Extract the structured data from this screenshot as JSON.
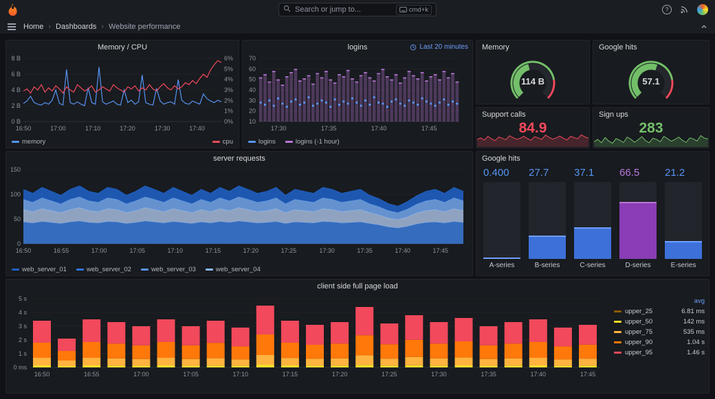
{
  "nav": {
    "search_placeholder": "Search or jump to...",
    "shortcut": "cmd+k",
    "help_glyph": "?",
    "separator": "›",
    "breadcrumb": [
      "Home",
      "Dashboards",
      "Website performance"
    ]
  },
  "panels": {
    "memcpu": {
      "title": "Memory / CPU",
      "legend": [
        {
          "label": "memory",
          "color": "#5794f2"
        },
        {
          "label": "cpu",
          "color": "#f2495c"
        }
      ],
      "chart_data": {
        "type": "line",
        "x_ticks": [
          {
            "label": "16:50",
            "f": 0
          },
          {
            "label": "17:00",
            "f": 0.175
          },
          {
            "label": "17:10",
            "f": 0.351
          },
          {
            "label": "17:20",
            "f": 0.526
          },
          {
            "label": "17:30",
            "f": 0.702
          },
          {
            "label": "17:40",
            "f": 0.877
          }
        ],
        "y_left": {
          "max": 8,
          "ticks": [
            {
              "label": "0 B",
              "v": 0
            },
            {
              "label": "2 B",
              "v": 2
            },
            {
              "label": "4 B",
              "v": 4
            },
            {
              "label": "6 B",
              "v": 6
            },
            {
              "label": "8 B",
              "v": 8
            }
          ]
        },
        "y_right": {
          "max": 6,
          "ticks": [
            {
              "label": "0%",
              "v": 0
            },
            {
              "label": "1%",
              "v": 1
            },
            {
              "label": "2%",
              "v": 2
            },
            {
              "label": "3%",
              "v": 3
            },
            {
              "label": "4%",
              "v": 4
            },
            {
              "label": "5%",
              "v": 5
            },
            {
              "label": "6%",
              "v": 6
            }
          ]
        },
        "series": [
          {
            "name": "memory",
            "axis": "left",
            "color": "#5794f2",
            "values": [
              2.3,
              2.6,
              3.2,
              2.4,
              2.2,
              2.1,
              2.4,
              2.2,
              2.7,
              4.0,
              2.3,
              2.1,
              6.6,
              2.4,
              2.2,
              2.5,
              2.2,
              2.0,
              4.3,
              2.4,
              2.2,
              6.9,
              2.5,
              2.2,
              2.4,
              2.6,
              2.2,
              2.1,
              4.0,
              2.4,
              2.7,
              2.2,
              2.5,
              5.9,
              2.4,
              2.2,
              2.1,
              4.2,
              2.6,
              2.2,
              2.4,
              2.5,
              2.2,
              5.3,
              2.7,
              2.3,
              2.2,
              2.6,
              2.4,
              2.2,
              3.5,
              2.9,
              2.6,
              2.4,
              2.7,
              2.5
            ]
          },
          {
            "name": "cpu",
            "axis": "right",
            "color": "#f2495c",
            "values": [
              2.9,
              3.1,
              2.7,
              3.3,
              3.0,
              3.5,
              2.8,
              3.2,
              2.9,
              3.4,
              3.1,
              2.7,
              3.3,
              3.0,
              2.8,
              3.5,
              3.2,
              2.9,
              3.1,
              3.4,
              2.8,
              3.0,
              3.3,
              3.1,
              2.9,
              3.5,
              3.2,
              3.0,
              2.8,
              3.3,
              3.1,
              3.4,
              2.9,
              3.2,
              3.0,
              3.5,
              3.1,
              2.9,
              3.3,
              3.6,
              3.2,
              3.0,
              3.4,
              3.1,
              3.3,
              3.7,
              3.5,
              3.9,
              3.6,
              4.1,
              4.5,
              4.2,
              4.9,
              5.4,
              5.8,
              5.6
            ]
          }
        ]
      }
    },
    "logins": {
      "title": "logins",
      "badge": "Last 20 minutes",
      "legend": [
        {
          "label": "logins",
          "color": "#5794f2"
        },
        {
          "label": "logins (-1 hour)",
          "color": "#b877d9"
        }
      ],
      "chart_data": {
        "type": "bar+scatter",
        "x_ticks": [
          {
            "label": "17:30",
            "f": 0.1
          },
          {
            "label": "17:35",
            "f": 0.35
          },
          {
            "label": "17:40",
            "f": 0.6
          },
          {
            "label": "17:45",
            "f": 0.85
          }
        ],
        "y": {
          "min": 10,
          "max": 70,
          "ticks": [
            {
              "label": "10",
              "v": 10
            },
            {
              "label": "20",
              "v": 20
            },
            {
              "label": "30",
              "v": 30
            },
            {
              "label": "40",
              "v": 40
            },
            {
              "label": "50",
              "v": 50
            },
            {
              "label": "60",
              "v": 60
            },
            {
              "label": "70",
              "v": 70
            }
          ]
        },
        "bar_color": "#b877d9",
        "point_color": "#5794f2",
        "bars": [
          52,
          55,
          48,
          58,
          50,
          45,
          53,
          57,
          60,
          49,
          51,
          54,
          46,
          56,
          52,
          58,
          50,
          47,
          55,
          53,
          59,
          51,
          48,
          54,
          57,
          52,
          49,
          56,
          60,
          53,
          50,
          55,
          47,
          52,
          58,
          54,
          51,
          57,
          49,
          53,
          55,
          50,
          58,
          52,
          56,
          48
        ],
        "points": [
          28,
          26,
          30,
          25,
          32,
          27,
          24,
          29,
          31,
          26,
          28,
          33,
          25,
          27,
          30,
          28,
          24,
          31,
          26,
          29,
          27,
          32,
          28,
          25,
          30,
          26,
          33,
          28,
          27,
          24,
          29,
          31,
          27,
          25,
          30,
          28,
          26,
          32,
          29,
          27,
          25,
          28,
          31,
          26,
          29,
          27
        ]
      }
    },
    "memory_gauge": {
      "title": "Memory",
      "value": "114 B",
      "percent": 0.45,
      "color": "#73bf69",
      "threshold_color": "#f2495c"
    },
    "google_gauge": {
      "title": "Google hits",
      "value": "57.1",
      "percent": 0.57,
      "color": "#73bf69",
      "threshold_color": "#f2495c"
    },
    "support": {
      "title": "Support calls",
      "value": "84.9",
      "color": "#f2495c",
      "spark_min": 60,
      "spark_max": 100,
      "spark": [
        80,
        85,
        78,
        90,
        82,
        76,
        88,
        84,
        79,
        92,
        86,
        80,
        84,
        90,
        83,
        77,
        89,
        85,
        80,
        94,
        87,
        81,
        85,
        91,
        84,
        78,
        90,
        86,
        82,
        95,
        88,
        84
      ]
    },
    "signups": {
      "title": "Sign ups",
      "value": "283",
      "color": "#73bf69",
      "spark_min": 240,
      "spark_max": 320,
      "spark": [
        265,
        280,
        258,
        292,
        270,
        255,
        285,
        275,
        260,
        295,
        282,
        262,
        278,
        298,
        272,
        258,
        288,
        280,
        265,
        300,
        285,
        268,
        280,
        295,
        275,
        260,
        290,
        283,
        270,
        305,
        288,
        283
      ]
    },
    "server": {
      "title": "server requests",
      "legend": [
        {
          "label": "web_server_01",
          "color": "#1f60c4"
        },
        {
          "label": "web_server_02",
          "color": "#3274d9"
        },
        {
          "label": "web_server_03",
          "color": "#5794f2"
        },
        {
          "label": "web_server_04",
          "color": "#8ab8ff"
        }
      ],
      "chart_data": {
        "type": "stacked-area",
        "x_ticks": [
          {
            "label": "16:50",
            "f": 0
          },
          {
            "label": "16:55",
            "f": 0.086
          },
          {
            "label": "17:00",
            "f": 0.172
          },
          {
            "label": "17:05",
            "f": 0.259
          },
          {
            "label": "17:10",
            "f": 0.345
          },
          {
            "label": "17:15",
            "f": 0.431
          },
          {
            "label": "17:20",
            "f": 0.517
          },
          {
            "label": "17:25",
            "f": 0.603
          },
          {
            "label": "17:30",
            "f": 0.69
          },
          {
            "label": "17:35",
            "f": 0.776
          },
          {
            "label": "17:40",
            "f": 0.862
          },
          {
            "label": "17:45",
            "f": 0.948
          }
        ],
        "y": {
          "max": 150,
          "ticks": [
            {
              "label": "0",
              "v": 0
            },
            {
              "label": "50",
              "v": 50
            },
            {
              "label": "100",
              "v": 100
            },
            {
              "label": "150",
              "v": 150
            }
          ]
        },
        "series": [
          {
            "name": "web_server_01",
            "color": "#1f60c4",
            "fill": "#3a77d4",
            "values": [
              44,
              42,
              45,
              43,
              41,
              44,
              46,
              43,
              42,
              45,
              44,
              41,
              43,
              46,
              44,
              42,
              45,
              43,
              41,
              44,
              42,
              45,
              43,
              46,
              44,
              42,
              43,
              45,
              41,
              44,
              43,
              42,
              45,
              44,
              42,
              43,
              44,
              41,
              38,
              34,
              32,
              35,
              40,
              43,
              44,
              42,
              45,
              43
            ]
          },
          {
            "name": "web_server_02",
            "color": "#3274d9",
            "fill": "#9fb6d8",
            "values": [
              25,
              23,
              26,
              24,
              22,
              25,
              27,
              24,
              23,
              26,
              25,
              22,
              24,
              27,
              25,
              23,
              26,
              24,
              22,
              25,
              23,
              26,
              24,
              27,
              25,
              23,
              24,
              26,
              22,
              25,
              24,
              23,
              26,
              25,
              23,
              24,
              25,
              22,
              20,
              18,
              17,
              19,
              22,
              24,
              25,
              23,
              26,
              24
            ]
          },
          {
            "name": "web_server_03",
            "color": "#5794f2",
            "fill": "#6fa3e8",
            "values": [
              21,
              19,
              22,
              20,
              18,
              21,
              22,
              20,
              19,
              22,
              21,
              18,
              20,
              22,
              21,
              19,
              22,
              20,
              18,
              21,
              19,
              22,
              20,
              22,
              21,
              19,
              20,
              22,
              18,
              21,
              20,
              19,
              22,
              21,
              19,
              20,
              21,
              18,
              17,
              15,
              14,
              16,
              18,
              20,
              21,
              19,
              22,
              20
            ]
          },
          {
            "name": "web_server_04",
            "color": "#8ab8ff",
            "fill": "#1f60c4",
            "values": [
              20,
              18,
              21,
              19,
              17,
              20,
              22,
              19,
              18,
              21,
              20,
              17,
              19,
              22,
              20,
              18,
              21,
              19,
              17,
              20,
              18,
              21,
              19,
              22,
              20,
              18,
              19,
              21,
              17,
              20,
              19,
              18,
              21,
              20,
              18,
              19,
              20,
              17,
              16,
              14,
              13,
              15,
              17,
              19,
              20,
              18,
              21,
              19
            ]
          }
        ]
      }
    },
    "bargauge": {
      "title": "Google hits",
      "max": 90,
      "bars": [
        {
          "label": "A-series",
          "value": "0.400",
          "v": 0.4,
          "color": "#3d71d9",
          "cap": "#6e9fff",
          "text": "#5794f2"
        },
        {
          "label": "B-series",
          "value": "27.7",
          "v": 27.7,
          "color": "#3d71d9",
          "cap": "#6e9fff",
          "text": "#5794f2"
        },
        {
          "label": "C-series",
          "value": "37.1",
          "v": 37.1,
          "color": "#3d71d9",
          "cap": "#6e9fff",
          "text": "#5794f2"
        },
        {
          "label": "D-series",
          "value": "66.5",
          "v": 66.5,
          "color": "#8a3db6",
          "cap": "#b877d9",
          "text": "#b877d9"
        },
        {
          "label": "E-series",
          "value": "21.2",
          "v": 21.2,
          "color": "#3d71d9",
          "cap": "#6e9fff",
          "text": "#5794f2"
        }
      ]
    },
    "client": {
      "title": "client side full page load",
      "legend": {
        "header": "avg",
        "rows": [
          {
            "name": "upper_25",
            "value": "6.81 ms",
            "color": "#8a5a00"
          },
          {
            "name": "upper_50",
            "value": "142 ms",
            "color": "#fade2a"
          },
          {
            "name": "upper_75",
            "value": "535 ms",
            "color": "#ffb340"
          },
          {
            "name": "upper_90",
            "value": "1.04 s",
            "color": "#ff780a"
          },
          {
            "name": "upper_95",
            "value": "1.46 s",
            "color": "#f2495c"
          }
        ]
      },
      "chart_data": {
        "type": "stacked-bar",
        "segment_names": [
          "upper_50",
          "upper_75",
          "upper_90",
          "upper_95"
        ],
        "colors": [
          "#fade2a",
          "#ffb340",
          "#ff780a",
          "#f2495c"
        ],
        "x_ticks": [
          "16:50",
          "16:55",
          "17:00",
          "17:05",
          "17:10",
          "17:15",
          "17:20",
          "17:25",
          "17:30",
          "17:35",
          "17:40",
          "17:45"
        ],
        "y_ticks": [
          {
            "label": "0 ms",
            "v": 0
          },
          {
            "label": "1 s",
            "v": 1
          },
          {
            "label": "2 s",
            "v": 2
          },
          {
            "label": "3 s",
            "v": 3
          },
          {
            "label": "4 s",
            "v": 4
          },
          {
            "label": "5 s",
            "v": 5
          }
        ],
        "y_max": 5,
        "bars": [
          [
            0.15,
            0.55,
            1.1,
            1.6
          ],
          [
            0.1,
            0.4,
            0.7,
            0.9
          ],
          [
            0.15,
            0.55,
            1.15,
            1.65
          ],
          [
            0.14,
            0.52,
            1.08,
            1.56
          ],
          [
            0.13,
            0.48,
            1.0,
            1.39
          ],
          [
            0.15,
            0.55,
            1.15,
            1.65
          ],
          [
            0.13,
            0.48,
            1.0,
            1.39
          ],
          [
            0.14,
            0.53,
            1.12,
            1.61
          ],
          [
            0.12,
            0.46,
            0.95,
            1.37
          ],
          [
            0.2,
            0.7,
            1.5,
            2.1
          ],
          [
            0.15,
            0.54,
            1.11,
            1.6
          ],
          [
            0.13,
            0.5,
            1.02,
            1.45
          ],
          [
            0.14,
            0.52,
            1.08,
            1.56
          ],
          [
            0.19,
            0.69,
            1.46,
            2.06
          ],
          [
            0.14,
            0.5,
            1.05,
            1.51
          ],
          [
            0.16,
            0.6,
            1.25,
            1.79
          ],
          [
            0.14,
            0.52,
            1.08,
            1.56
          ],
          [
            0.15,
            0.57,
            1.18,
            1.7
          ],
          [
            0.13,
            0.48,
            1.0,
            1.39
          ],
          [
            0.14,
            0.52,
            1.08,
            1.56
          ],
          [
            0.15,
            0.55,
            1.15,
            1.65
          ],
          [
            0.12,
            0.46,
            0.95,
            1.37
          ],
          [
            0.14,
            0.5,
            1.02,
            1.44
          ]
        ]
      }
    }
  }
}
